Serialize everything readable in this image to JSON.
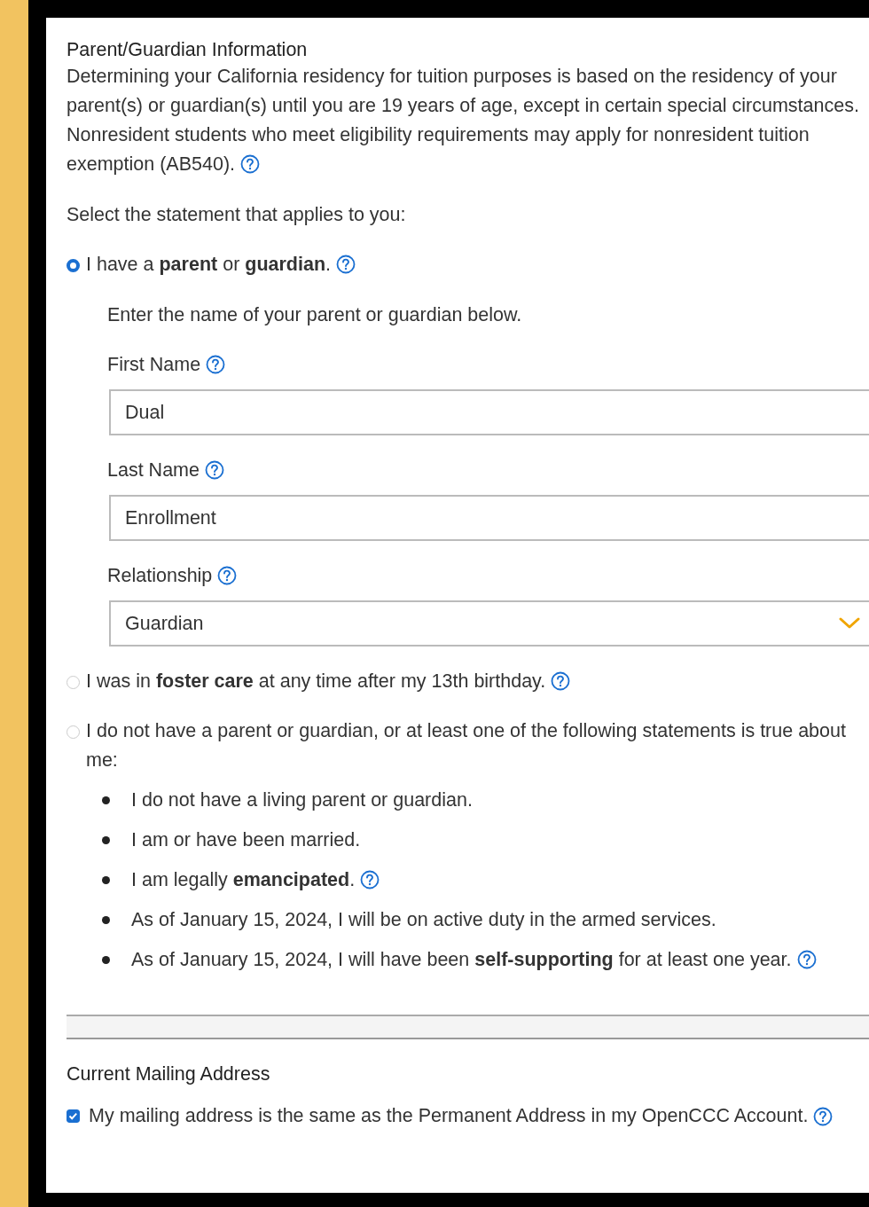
{
  "section": {
    "title": "Parent/Guardian Information",
    "description_lines": [
      "Determining your California residency for tuition purposes is based on the residency of your",
      "parent(s) or guardian(s) until you are 19 years of age, except in certain special circumstances.",
      "Nonresident students who meet eligibility requirements may apply for nonresident tuition",
      "exemption (AB540)."
    ],
    "help": true,
    "prompt": "Select the statement that applies to you:"
  },
  "options": [
    {
      "label": "I have a **parent** or **guardian**.",
      "selected": true,
      "help": true,
      "instruction": "Enter the name of your parent or guardian below.",
      "fields": [
        {
          "kind": "text",
          "label": "First Name",
          "help": true,
          "value": "Dual"
        },
        {
          "kind": "text",
          "label": "Last Name",
          "help": true,
          "value": "Enrollment"
        },
        {
          "kind": "select",
          "label": "Relationship",
          "help": true,
          "value": "Guardian"
        }
      ]
    },
    {
      "label": "I was in **foster care** at any time after my 13th birthday.",
      "selected": false,
      "help": true
    },
    {
      "label": "I do not have a parent or guardian, or at least one of the following statements is true about me:",
      "selected": false,
      "help": false,
      "bullets": [
        {
          "text": "I do not have a living parent or guardian.",
          "help": false
        },
        {
          "text": "I am or have been married.",
          "help": false
        },
        {
          "text": "I am legally **emancipated**.",
          "help": true
        },
        {
          "text": "As of January 15, 2024, I will be on active duty in the armed services.",
          "help": false
        },
        {
          "text": "As of January 15, 2024, I will have been **self-supporting** for at least one year.",
          "help": true
        }
      ]
    }
  ],
  "mailing": {
    "title": "Current Mailing Address",
    "checkbox": {
      "label": "My mailing address is the same as the Permanent Address in my OpenCCC Account.",
      "checked": true,
      "help": true
    }
  }
}
